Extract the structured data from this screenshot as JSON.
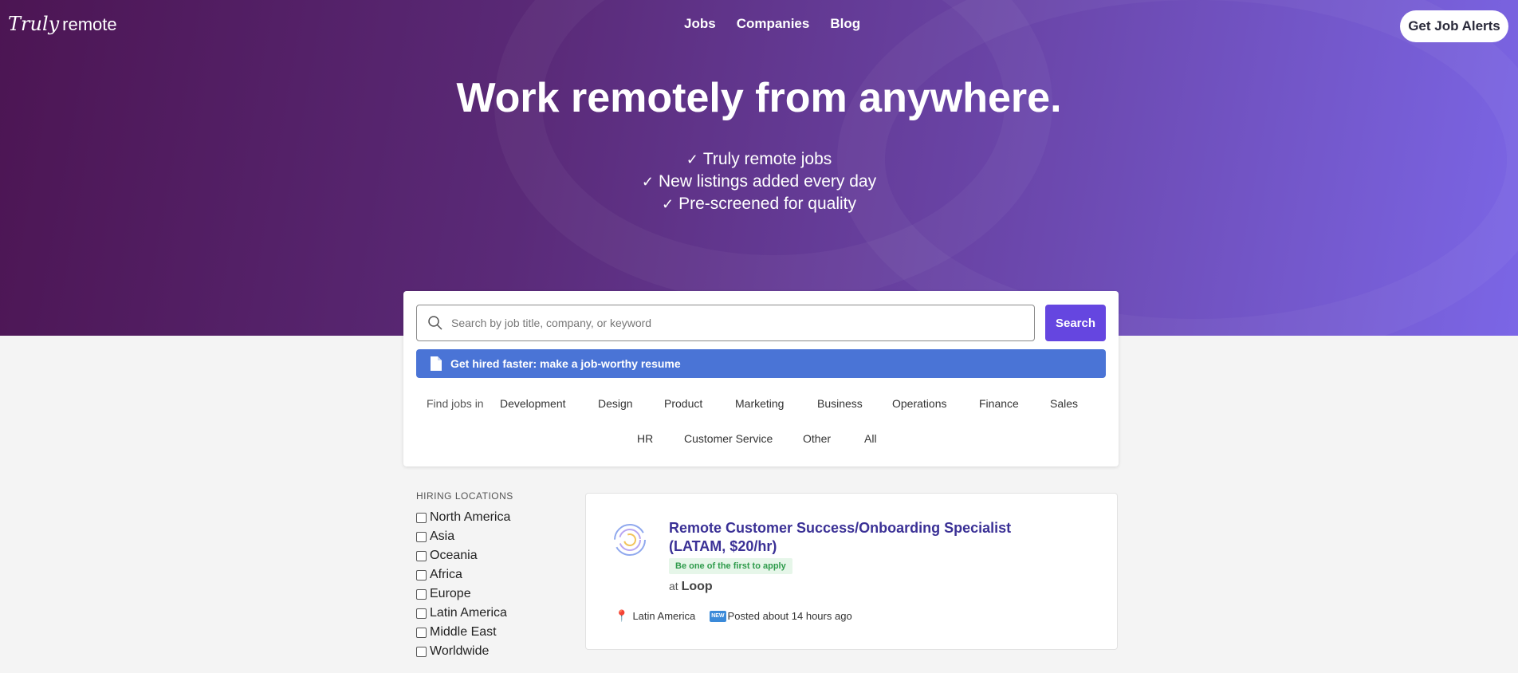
{
  "brand": {
    "logo_script": "Truly",
    "logo_plain": "remote"
  },
  "nav": {
    "items": [
      "Jobs",
      "Companies",
      "Blog"
    ],
    "cta": "Get Job Alerts"
  },
  "hero": {
    "headline": "Work remotely from anywhere.",
    "benefits": [
      "Truly remote jobs",
      "New listings added every day",
      "Pre-screened for quality"
    ]
  },
  "search": {
    "placeholder": "Search by job title, company, or keyword",
    "button": "Search"
  },
  "resume_banner": "Get hired faster: make a job-worthy resume",
  "categories": {
    "label": "Find jobs in",
    "items": [
      "Development",
      "Design",
      "Product",
      "Marketing",
      "Business",
      "Operations",
      "Finance",
      "Sales",
      "HR",
      "Customer Service",
      "Other",
      "All"
    ]
  },
  "sidebar": {
    "heading": "HIRING LOCATIONS",
    "locations": [
      "North America",
      "Asia",
      "Oceania",
      "Africa",
      "Europe",
      "Latin America",
      "Middle East",
      "Worldwide"
    ]
  },
  "job": {
    "title": "Remote Customer Success/Onboarding Specialist (LATAM, $20/hr)",
    "badge": "Be one of the first to apply",
    "company_prefix": "at",
    "company": "Loop",
    "location": "Latin America",
    "new_tag": "NEW",
    "posted": "Posted about 14 hours ago"
  },
  "colors": {
    "accent": "#6546e0",
    "banner": "#4a74d6",
    "title": "#3b3196",
    "badge_text": "#2e9b4b"
  }
}
